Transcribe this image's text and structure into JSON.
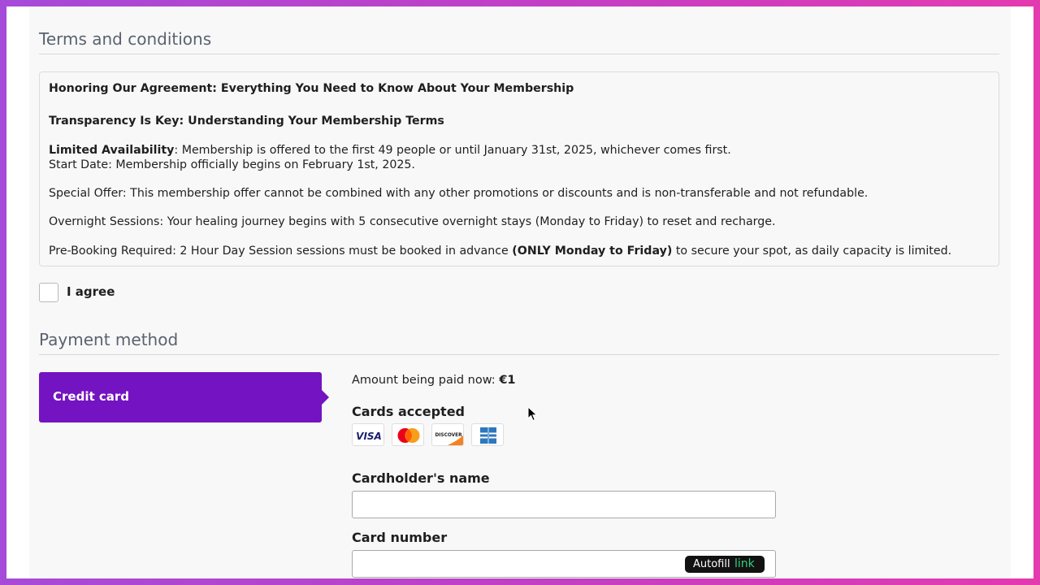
{
  "terms": {
    "title": "Terms and conditions",
    "heading1": "Honoring Our Agreement: Everything You Need to Know About Your Membership",
    "heading2": "Transparency Is Key: Understanding Your Membership Terms",
    "limited_bold": "Limited Availability",
    "limited_text": ": Membership is offered to the first 49 people or until January 31st, 2025, whichever comes first.",
    "start_date": "Start Date: Membership officially begins on February 1st, 2025.",
    "special_offer": "Special Offer: This membership offer cannot be combined with any other promotions or discounts and is non-transferable and not refundable.",
    "overnight": "Overnight Sessions: Your healing journey begins with 5 consecutive overnight stays (Monday to Friday) to reset and recharge.",
    "prebook_start": "Pre-Booking Required: 2 Hour Day Session sessions must be booked in advance ",
    "prebook_bold": "(ONLY Monday to Friday)",
    "prebook_end": " to secure your spot, as daily capacity is limited.",
    "agree_label": "I agree"
  },
  "payment": {
    "title": "Payment method",
    "method_tab": "Credit card",
    "amount_label": "Amount being paid now: ",
    "amount_value": "€1",
    "cards_accepted_label": "Cards accepted",
    "cards": [
      "visa",
      "mastercard",
      "discover",
      "amex"
    ],
    "visa_text": "VISA",
    "discover_text": "DISCOVER",
    "cardholder_label": "Cardholder's name",
    "cardholder_value": "",
    "card_number_label": "Card number",
    "card_number_value": "",
    "autofill_text": "Autofill",
    "autofill_brand": "link"
  },
  "colors": {
    "accent": "#7413c1",
    "frame_gradient_start": "#a64ad8",
    "frame_gradient_end": "#e43ab0"
  }
}
